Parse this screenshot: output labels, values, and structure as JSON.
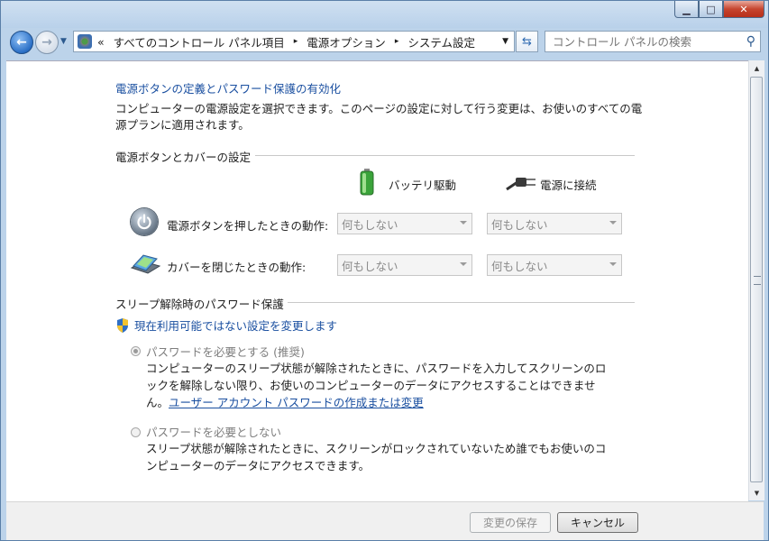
{
  "window": {
    "controls": {
      "minimize": "▁",
      "maximize": "□",
      "close": "✕"
    }
  },
  "toolbar": {
    "address": {
      "overflow": "«",
      "segments": [
        "すべてのコントロール パネル項目",
        "電源オプション",
        "システム設定"
      ],
      "separator": "▸"
    },
    "search_placeholder": "コントロール パネルの検索"
  },
  "page": {
    "heading_link": "電源ボタンの定義とパスワード保護の有効化",
    "intro": "コンピューターの電源設定を選択できます。このページの設定に対して行う変更は、お使いのすべての電源プランに適用されます。",
    "power_section": {
      "title": "電源ボタンとカバーの設定",
      "columns": {
        "battery": "バッテリ駆動",
        "plugged_in": "電源に接続"
      },
      "rows": [
        {
          "label": "電源ボタンを押したときの動作:",
          "battery": "何もしない",
          "plugged_in": "何もしない"
        },
        {
          "label": "カバーを閉じたときの動作:",
          "battery": "何もしない",
          "plugged_in": "何もしない"
        }
      ]
    },
    "password_section": {
      "title": "スリープ解除時のパスワード保護",
      "change_link": "現在利用可能ではない設定を変更します",
      "require": {
        "label": "パスワードを必要とする (推奨)",
        "desc_before": "コンピューターのスリープ状態が解除されたときに、パスワードを入力してスクリーンのロックを解除しない限り、お使いのコンピューターのデータにアクセスすることはできません。",
        "desc_link": "ユーザー アカウント パスワードの作成または変更",
        "selected": true
      },
      "no_require": {
        "label": "パスワードを必要としない",
        "desc": "スリープ状態が解除されたときに、スクリーンがロックされていないため誰でもお使いのコンピューターのデータにアクセスできます。",
        "selected": false
      }
    }
  },
  "footer": {
    "save": "変更の保存",
    "cancel": "キャンセル"
  },
  "colors": {
    "link": "#1a4fa0",
    "window_frame": "#bcd3ea",
    "battery_green": "#3aa33a"
  }
}
